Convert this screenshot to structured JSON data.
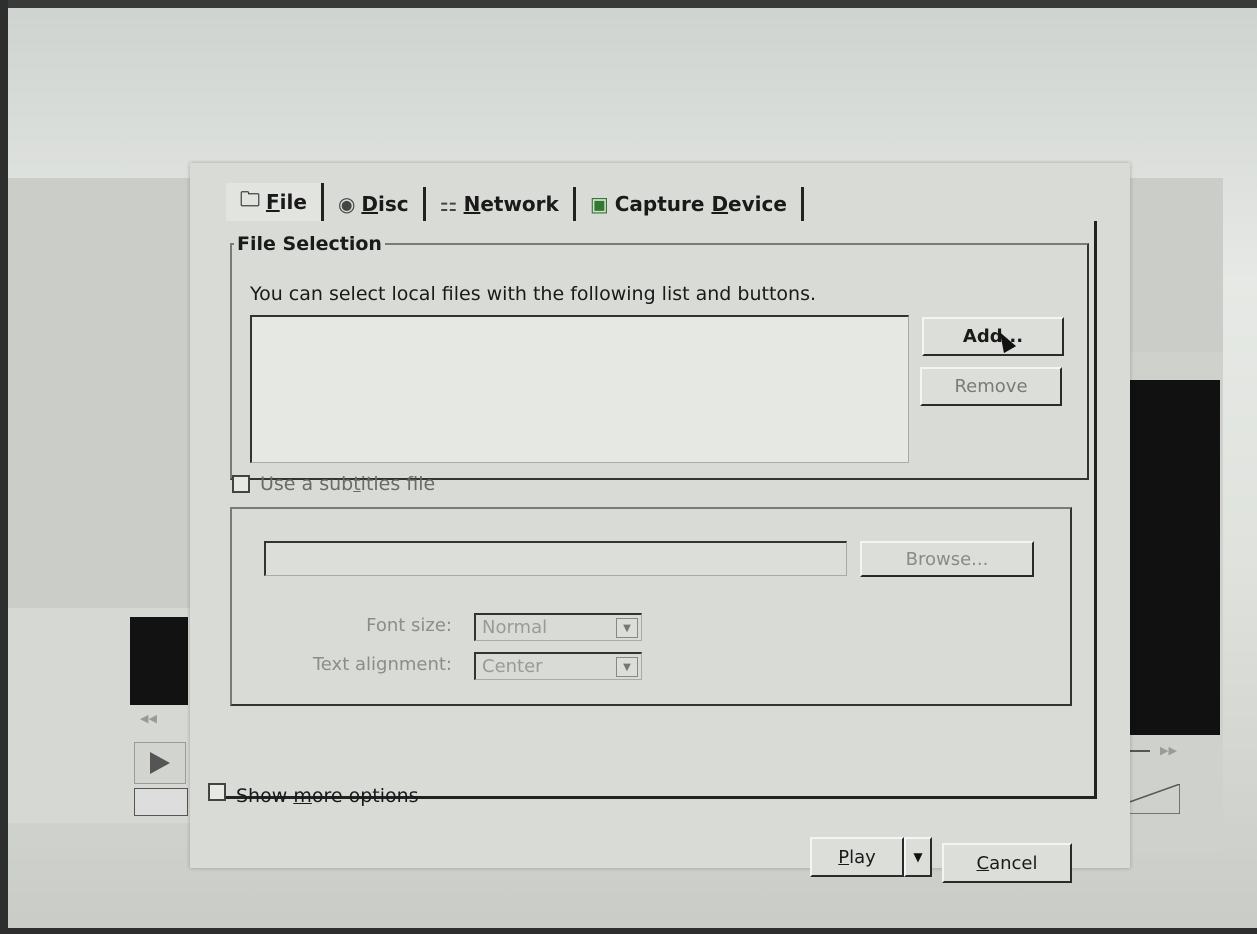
{
  "dialog": {
    "tabs": [
      {
        "label_pre": "",
        "label_ul": "F",
        "label_post": "ile",
        "icon": "folder-icon"
      },
      {
        "label_pre": "",
        "label_ul": "D",
        "label_post": "isc",
        "icon": "disc-icon"
      },
      {
        "label_pre": "",
        "label_ul": "N",
        "label_post": "etwork",
        "icon": "network-icon"
      },
      {
        "label_pre": "Capture ",
        "label_ul": "D",
        "label_post": "evice",
        "icon": "capture-card-icon"
      }
    ],
    "active_tab": "File",
    "file_selection": {
      "title": "File Selection",
      "hint": "You can select local files with the following list and buttons.",
      "add_label": "Add...",
      "remove_label": "Remove"
    },
    "subtitles": {
      "checkbox_pre": "Use a sub",
      "checkbox_ul": "t",
      "checkbox_post": "itles file",
      "browse_label": "Browse...",
      "font_size_label": "Font size:",
      "font_size_value": "Normal",
      "alignment_label": "Text alignment:",
      "alignment_value": "Center"
    },
    "more_options": {
      "pre": "Show ",
      "ul": "m",
      "post": "ore options"
    },
    "play": {
      "ul": "P",
      "post": "lay"
    },
    "cancel": {
      "ul": "C",
      "post": "ancel"
    }
  },
  "background_player": {
    "time": "-/--:--"
  },
  "colors": {
    "dialog_bg": "#d9dbd6",
    "volume_fill": "#e8d23a"
  }
}
